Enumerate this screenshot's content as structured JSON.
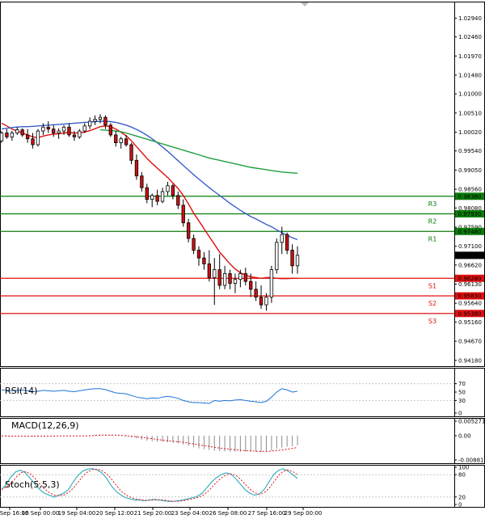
{
  "chart_data": {
    "type": "candlestick",
    "price_axis": {
      "ticks": [
        "1.02940",
        "1.02460",
        "1.01970",
        "1.01480",
        "1.01000",
        "1.00510",
        "1.00020",
        "0.99540",
        "0.99050",
        "0.98560",
        "0.98080",
        "0.97590",
        "0.97100",
        "0.96620",
        "0.96130",
        "0.95640",
        "0.95160",
        "0.94670",
        "0.94180"
      ],
      "range": [
        0.9403,
        1.033
      ]
    },
    "levels": [
      {
        "name": "R3",
        "value": 0.9838,
        "label": "0.98380",
        "color": "#0a7d0a"
      },
      {
        "name": "R2",
        "value": 0.9793,
        "label": "0.97930",
        "color": "#0a7d0a"
      },
      {
        "name": "R1",
        "value": 0.9748,
        "label": "0.97480",
        "color": "#0a7d0a"
      },
      {
        "name": "S1",
        "value": 0.9628,
        "label": "0.96280",
        "color": "#e01010"
      },
      {
        "name": "S2",
        "value": 0.9583,
        "label": "0.95830",
        "color": "#e01010"
      },
      {
        "name": "S3",
        "value": 0.9538,
        "label": "0.95380",
        "color": "#e01010"
      }
    ],
    "current_price": {
      "value": 0.96868,
      "label": "0.96868"
    },
    "date_labels": [
      "15 Sep 16:00",
      "16 Sep 00:00",
      "19 Sep 04:00",
      "20 Sep 12:00",
      "21 Sep 20:00",
      "23 Sep 04:00",
      "26 Sep 08:00",
      "27 Sep 16:00",
      "29 Sep 00:00"
    ],
    "candles": [
      [
        0.998,
        1.0005,
        0.9975,
        1.0
      ],
      [
        1.0,
        1.001,
        0.9985,
        0.999
      ],
      [
        0.999,
        1.0005,
        0.998,
        1.0
      ],
      [
        1.0,
        1.0015,
        0.9995,
        1.0008
      ],
      [
        1.0008,
        1.0012,
        0.999,
        0.9995
      ],
      [
        0.9995,
        1.001,
        0.9975,
        0.9985
      ],
      [
        0.9985,
        1.0,
        0.996,
        0.997
      ],
      [
        0.997,
        1.001,
        0.9965,
        1.0005
      ],
      [
        1.0005,
        1.0025,
        0.9995,
        1.0015
      ],
      [
        1.0015,
        1.003,
        1.0,
        1.001
      ],
      [
        1.001,
        1.002,
        0.999,
        1.0
      ],
      [
        1.0,
        1.0012,
        0.9985,
        1.0005
      ],
      [
        1.0005,
        1.002,
        0.9995,
        1.0015
      ],
      [
        1.0015,
        1.0025,
        0.999,
        0.9995
      ],
      [
        0.9995,
        1.0005,
        0.998,
        0.999
      ],
      [
        0.999,
        1.001,
        0.9985,
        1.0005
      ],
      [
        1.0005,
        1.0025,
        1.0,
        1.0018
      ],
      [
        1.0018,
        1.004,
        1.001,
        1.003
      ],
      [
        1.003,
        1.0045,
        1.002,
        1.0035
      ],
      [
        1.0035,
        1.0048,
        1.0025,
        1.004
      ],
      [
        1.004,
        1.0045,
        1.001,
        1.002
      ],
      [
        1.002,
        1.0025,
        0.999,
        0.9995
      ],
      [
        0.9995,
        1.0005,
        0.9965,
        0.9975
      ],
      [
        0.9975,
        0.999,
        0.996,
        0.9985
      ],
      [
        0.9985,
        0.9995,
        0.9965,
        0.997
      ],
      [
        0.997,
        0.9975,
        0.992,
        0.993
      ],
      [
        0.993,
        0.9945,
        0.988,
        0.989
      ],
      [
        0.989,
        0.99,
        0.985,
        0.986
      ],
      [
        0.986,
        0.987,
        0.982,
        0.983
      ],
      [
        0.983,
        0.9845,
        0.981,
        0.984
      ],
      [
        0.984,
        0.9855,
        0.9815,
        0.9825
      ],
      [
        0.9825,
        0.986,
        0.982,
        0.985
      ],
      [
        0.985,
        0.9875,
        0.984,
        0.9865
      ],
      [
        0.9865,
        0.987,
        0.983,
        0.984
      ],
      [
        0.984,
        0.985,
        0.9805,
        0.9815
      ],
      [
        0.9815,
        0.983,
        0.976,
        0.977
      ],
      [
        0.977,
        0.978,
        0.972,
        0.973
      ],
      [
        0.973,
        0.974,
        0.969,
        0.97
      ],
      [
        0.97,
        0.971,
        0.966,
        0.968
      ],
      [
        0.968,
        0.9695,
        0.965,
        0.9665
      ],
      [
        0.9665,
        0.97,
        0.962,
        0.963
      ],
      [
        0.963,
        0.968,
        0.956,
        0.965
      ],
      [
        0.965,
        0.969,
        0.96,
        0.961
      ],
      [
        0.961,
        0.966,
        0.96,
        0.964
      ],
      [
        0.964,
        0.965,
        0.96,
        0.9615
      ],
      [
        0.9615,
        0.964,
        0.959,
        0.9625
      ],
      [
        0.9625,
        0.965,
        0.9605,
        0.964
      ],
      [
        0.964,
        0.9655,
        0.961,
        0.962
      ],
      [
        0.962,
        0.964,
        0.958,
        0.96
      ],
      [
        0.96,
        0.962,
        0.957,
        0.958
      ],
      [
        0.958,
        0.961,
        0.955,
        0.956
      ],
      [
        0.956,
        0.959,
        0.9545,
        0.958
      ],
      [
        0.958,
        0.966,
        0.9565,
        0.965
      ],
      [
        0.965,
        0.973,
        0.964,
        0.972
      ],
      [
        0.972,
        0.976,
        0.969,
        0.974
      ],
      [
        0.974,
        0.9745,
        0.969,
        0.97
      ],
      [
        0.97,
        0.9715,
        0.964,
        0.966
      ],
      [
        0.966,
        0.971,
        0.964,
        0.9687
      ]
    ],
    "moving_averages": [
      {
        "color": "#e01010",
        "values": [
          1.0025,
          1.0018,
          1.001,
          1.0005,
          1.0,
          0.9995,
          0.999,
          0.9988,
          0.9992,
          0.9995,
          0.9997,
          0.9998,
          1.0,
          1.0001,
          1.0,
          1.0,
          1.0002,
          1.0006,
          1.0011,
          1.0016,
          1.0018,
          1.0016,
          1.001,
          1.0002,
          0.9993,
          0.998,
          0.9965,
          0.995,
          0.9935,
          0.9922,
          0.991,
          0.9898,
          0.9886,
          0.9872,
          0.9858,
          0.984,
          0.9818,
          0.9795,
          0.9775,
          0.9755,
          0.9735,
          0.9715,
          0.9695,
          0.968,
          0.9665,
          0.9652,
          0.9642,
          0.9636,
          0.9632,
          0.963,
          0.9628,
          0.963,
          0.963,
          0.9628,
          0.9627,
          0.9627,
          0.9628,
          0.9628
        ]
      },
      {
        "color": "#3a5fcd",
        "values": [
          1.001,
          1.0012,
          1.0014,
          1.0015,
          1.0016,
          1.0016,
          1.0017,
          1.0018,
          1.0019,
          1.002,
          1.0021,
          1.0022,
          1.0023,
          1.0024,
          1.0025,
          1.0026,
          1.0027,
          1.0028,
          1.0029,
          1.003,
          1.003,
          1.0029,
          1.0027,
          1.0024,
          1.002,
          1.0015,
          1.0009,
          1.0002,
          0.9994,
          0.9985,
          0.9975,
          0.9964,
          0.9953,
          0.9941,
          0.9929,
          0.9917,
          0.9905,
          0.9893,
          0.9882,
          0.9871,
          0.986,
          0.985,
          0.984,
          0.983,
          0.982,
          0.9811,
          0.9802,
          0.9794,
          0.9786,
          0.978,
          0.9773,
          0.9766,
          0.976,
          0.9752,
          0.9745,
          0.9738,
          0.9732,
          0.9727
        ]
      },
      {
        "color": "#1f9e3f",
        "values": [
          null,
          null,
          null,
          null,
          null,
          null,
          null,
          null,
          null,
          null,
          null,
          null,
          null,
          null,
          null,
          null,
          null,
          null,
          null,
          1.0008,
          1.0007,
          1.0006,
          1.0005,
          1.0003,
          1.0,
          0.9996,
          0.9992,
          0.9988,
          0.9984,
          0.998,
          0.9976,
          0.9972,
          0.9968,
          0.9964,
          0.996,
          0.9956,
          0.9952,
          0.9948,
          0.9944,
          0.994,
          0.9936,
          0.9933,
          0.993,
          0.9927,
          0.9924,
          0.9921,
          0.9918,
          0.9915,
          0.9912,
          0.991,
          0.9908,
          0.9906,
          0.9904,
          0.9902,
          0.99,
          0.9899,
          0.9898,
          0.9897
        ]
      }
    ],
    "indicators": [
      {
        "name": "RSI(14)",
        "color": "#1e73d8",
        "ticks": [
          "70",
          "50",
          "30",
          "0"
        ],
        "range": [
          0,
          100
        ],
        "values": [
          55,
          54,
          53,
          54,
          55,
          53,
          51,
          52,
          54,
          53,
          52,
          53,
          54,
          52,
          51,
          53,
          55,
          57,
          58,
          58,
          56,
          52,
          48,
          47,
          46,
          42,
          38,
          36,
          34,
          36,
          35,
          38,
          40,
          38,
          35,
          30,
          27,
          25,
          25,
          24,
          23,
          30,
          28,
          30,
          29,
          31,
          32,
          30,
          28,
          27,
          25,
          28,
          38,
          50,
          58,
          55,
          50,
          52
        ]
      },
      {
        "name": "MACD(12,26,9)",
        "color": "#8c8c8c",
        "signal_color": "#e01010",
        "ticks": [
          "0.005271",
          "0.00",
          "-0.008817"
        ],
        "range": [
          -0.008817,
          0.005271
        ],
        "histogram": [
          -0.0001,
          -0.0002,
          -0.0002,
          -0.0001,
          -0.0001,
          -0.0002,
          -0.0003,
          -0.0002,
          -0.0001,
          -0.0001,
          -0.0001,
          0.0,
          0.0,
          -0.0001,
          -0.0001,
          0.0,
          0.0001,
          0.0002,
          0.0003,
          0.0004,
          0.0004,
          0.0003,
          0.0001,
          -0.0001,
          -0.0003,
          -0.0006,
          -0.001,
          -0.0014,
          -0.0018,
          -0.002,
          -0.0022,
          -0.0023,
          -0.0024,
          -0.0026,
          -0.0028,
          -0.0032,
          -0.0037,
          -0.0042,
          -0.0046,
          -0.0049,
          -0.0052,
          -0.0054,
          -0.0056,
          -0.0057,
          -0.0058,
          -0.0058,
          -0.0058,
          -0.0058,
          -0.0058,
          -0.0059,
          -0.0059,
          -0.0058,
          -0.0054,
          -0.0048,
          -0.0043,
          -0.004,
          -0.0038,
          -0.0035
        ],
        "signal": [
          -0.0001,
          -0.0001,
          -0.0002,
          -0.0002,
          -0.0002,
          -0.0002,
          -0.0002,
          -0.0002,
          -0.0002,
          -0.0002,
          -0.0002,
          -0.0001,
          -0.0001,
          -0.0001,
          -0.0001,
          -0.0001,
          -0.0001,
          0.0,
          0.0001,
          0.0002,
          0.0002,
          0.0002,
          0.0002,
          0.0001,
          0.0,
          -0.0002,
          -0.0004,
          -0.0006,
          -0.0009,
          -0.0011,
          -0.0014,
          -0.0016,
          -0.0018,
          -0.002,
          -0.0022,
          -0.0024,
          -0.0027,
          -0.003,
          -0.0033,
          -0.0036,
          -0.0039,
          -0.0042,
          -0.0045,
          -0.0047,
          -0.0049,
          -0.0051,
          -0.0053,
          -0.0054,
          -0.0055,
          -0.0056,
          -0.0057,
          -0.0057,
          -0.0056,
          -0.0054,
          -0.0052,
          -0.0049,
          -0.0046,
          -0.0043
        ]
      },
      {
        "name": "Stoch(5,5,3)",
        "k_color": "#1aa3b8",
        "d_color": "#e01010",
        "ticks": [
          "100",
          "80",
          "20",
          "0"
        ],
        "range": [
          0,
          100
        ],
        "k": [
          40,
          55,
          75,
          88,
          92,
          85,
          70,
          55,
          40,
          30,
          25,
          20,
          25,
          30,
          40,
          60,
          78,
          90,
          95,
          96,
          93,
          85,
          70,
          50,
          35,
          25,
          18,
          15,
          12,
          12,
          10,
          12,
          14,
          12,
          10,
          8,
          8,
          10,
          12,
          15,
          18,
          22,
          30,
          45,
          60,
          72,
          80,
          85,
          82,
          70,
          55,
          40,
          30,
          25,
          28,
          40,
          60,
          80,
          92,
          96,
          90,
          80,
          70
        ]
      }
    ]
  }
}
